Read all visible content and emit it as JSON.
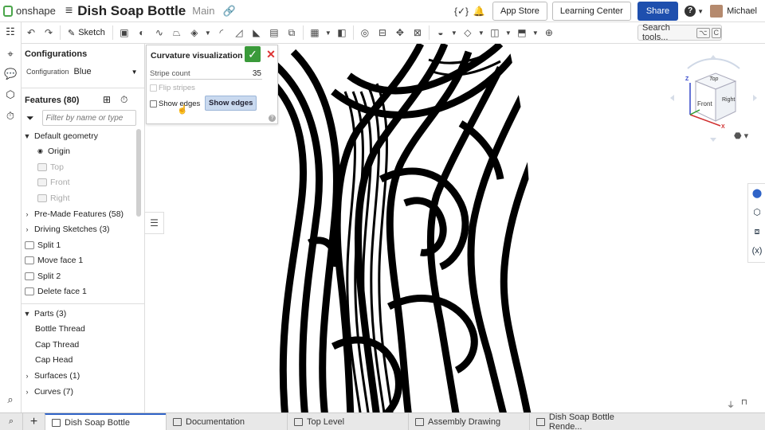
{
  "topbar": {
    "logo_text": "onshape",
    "doc_title": "Dish Soap Bottle",
    "workspace": "Main",
    "app_store": "App Store",
    "learning_center": "Learning Center",
    "share": "Share",
    "user": "Michael"
  },
  "toolbar": {
    "sketch_label": "Sketch",
    "search_label": "Search tools...",
    "search_shortcut_1": "⌥",
    "search_shortcut_2": "C"
  },
  "configurations": {
    "title": "Configurations",
    "label": "Configuration",
    "value": "Blue"
  },
  "features": {
    "title": "Features (80)",
    "filter_placeholder": "Filter by name or type",
    "items": [
      {
        "label": "Default geometry"
      },
      {
        "label": "Origin"
      },
      {
        "label": "Top"
      },
      {
        "label": "Front"
      },
      {
        "label": "Right"
      },
      {
        "label": "Pre-Made Features (58)"
      },
      {
        "label": "Driving Sketches (3)"
      },
      {
        "label": "Split 1"
      },
      {
        "label": "Move face 1"
      },
      {
        "label": "Split 2"
      },
      {
        "label": "Delete face 1"
      }
    ]
  },
  "parts": {
    "items": [
      {
        "label": "Parts (3)"
      },
      {
        "label": "Bottle Thread"
      },
      {
        "label": "Cap Thread"
      },
      {
        "label": "Cap Head"
      },
      {
        "label": "Surfaces (1)"
      },
      {
        "label": "Curves (7)"
      }
    ]
  },
  "dialog": {
    "title": "Curvature visualization",
    "stripe_label": "Stripe count",
    "stripe_value": "35",
    "flip_label": "Flip stripes",
    "show_edges_label": "Show edges",
    "show_edges_button": "Show edges"
  },
  "viewcube": {
    "top": "Top",
    "front": "Front",
    "right": "Right",
    "axis_z": "Z",
    "axis_x": "X"
  },
  "tabs": [
    {
      "label": "Dish Soap Bottle"
    },
    {
      "label": "Documentation"
    },
    {
      "label": "Top Level"
    },
    {
      "label": "Assembly Drawing"
    },
    {
      "label": "Dish Soap Bottle Rende..."
    }
  ]
}
